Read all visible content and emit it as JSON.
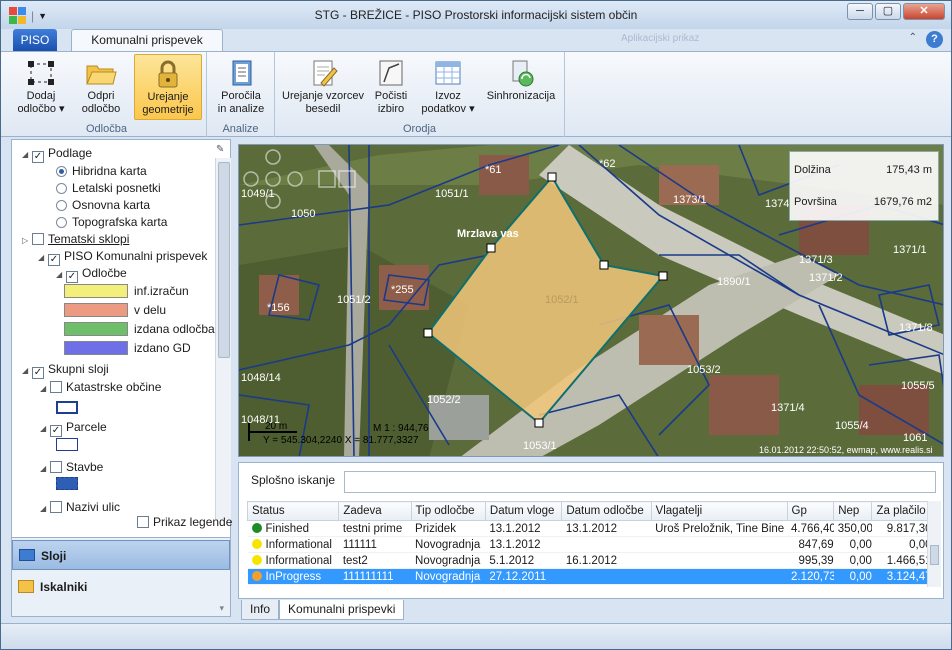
{
  "window": {
    "title": "STG - BREŽICE - PISO Prostorski informacijski sistem občin",
    "ghost_text": "Aplikacijski prikaz"
  },
  "tabs": {
    "piso": "PISO",
    "komunalni": "Komunalni prispevek"
  },
  "ribbon": {
    "groups": [
      {
        "label": "Odločba",
        "buttons": [
          {
            "line1": "Dodaj",
            "line2": "odločbo ▾",
            "icon": "add-polygon-icon"
          },
          {
            "line1": "Odpri",
            "line2": "odločbo",
            "icon": "folder-open-icon"
          },
          {
            "line1": "Urejanje",
            "line2": "geometrije",
            "icon": "lock-icon"
          }
        ]
      },
      {
        "label": "Analize",
        "buttons": [
          {
            "line1": "Poročila",
            "line2": "in analize",
            "icon": "report-book-icon"
          }
        ]
      },
      {
        "label": "Orodja",
        "buttons": [
          {
            "line1": "Urejanje vzorcev",
            "line2": "besedil",
            "icon": "edit-document-icon"
          },
          {
            "line1": "Počisti",
            "line2": "izbiro",
            "icon": "clear-selection-icon"
          },
          {
            "line1": "Izvoz",
            "line2": "podatkov ▾",
            "icon": "export-table-icon"
          },
          {
            "line1": "Sinhronizacija",
            "line2": "",
            "icon": "sync-icon"
          }
        ]
      }
    ]
  },
  "layers": {
    "podlage": "Podlage",
    "basemaps": [
      "Hibridna karta",
      "Letalski posnetki",
      "Osnovna karta",
      "Topografska karta"
    ],
    "tematski": "Tematski sklopi",
    "piso_kom": "PISO Komunalni prispevek",
    "odlocbe": "Odločbe",
    "legend": [
      {
        "label": "inf.izračun",
        "color": "#f2f07a"
      },
      {
        "label": "v delu",
        "color": "#ec9a82"
      },
      {
        "label": "izdana odločba",
        "color": "#6fbf6a"
      },
      {
        "label": "izdano GD",
        "color": "#6f6fe8"
      }
    ],
    "skupni": "Skupni sloji",
    "katastrske": "Katastrske občine",
    "parcele": "Parcele",
    "stavbe": "Stavbe",
    "nazivi": "Nazivi ulic",
    "prikaz_legende": "Prikaz legende"
  },
  "nav": {
    "sloji": "Sloji",
    "iskalniki": "Iskalniki"
  },
  "map": {
    "dolzina_label": "Dolžina",
    "dolzina": "175,43 m",
    "povrsina_label": "Površina",
    "povrsina": "1679,76 m2",
    "scale_bar": "20 m",
    "scale_ratio": "M 1 : 944,76",
    "coords": "Y = 545.304,2240  X = 81.777,3327",
    "stamp": "16.01.2012 22:50:52, ewmap, www.realis.si",
    "parcels": [
      "1051/1",
      "1050",
      "1049/1",
      "1373/1",
      "1374",
      "1371/1",
      "1371/3",
      "1371/2",
      "1371/8",
      "1890/1",
      "1052/1",
      "1051/2",
      "1053/2",
      "1052/2",
      "1053/1",
      "1055/4",
      "1048/14",
      "1048/11",
      "*61",
      "*62",
      "*156",
      "*255",
      "Mrzlava vas",
      "1061",
      "1055/5",
      "1371/4"
    ]
  },
  "search": {
    "label": "Splošno iskanje",
    "value": ""
  },
  "table": {
    "columns": [
      "Status",
      "Zadeva",
      "Tip odločbe",
      "Datum vloge",
      "Datum odločbe",
      "Vlagatelji",
      "Gp",
      "Nep",
      "Za plačilo"
    ],
    "rows": [
      {
        "status": "Finished",
        "color": "#1f8a2a",
        "zadeva": "testni prime",
        "tip": "Prizidek",
        "vloge": "13.1.2012",
        "odlocbe": "13.1.2012",
        "vlagatelji": "Uroš Preložnik, Tine Bine",
        "gp": "4.766,40",
        "nep": "350,00",
        "placilo": "9.817,30"
      },
      {
        "status": "Informational",
        "color": "#f5e500",
        "zadeva": "111111",
        "tip": "Novogradnja",
        "vloge": "13.1.2012",
        "odlocbe": "",
        "vlagatelji": "",
        "gp": "847,69",
        "nep": "0,00",
        "placilo": "0,00"
      },
      {
        "status": "Informational",
        "color": "#f5e500",
        "zadeva": "test2",
        "tip": "Novogradnja",
        "vloge": "5.1.2012",
        "odlocbe": "16.1.2012",
        "vlagatelji": "",
        "gp": "995,39",
        "nep": "0,00",
        "placilo": "1.466,51"
      },
      {
        "status": "InProgress",
        "color": "#f0a030",
        "zadeva": "111111111",
        "tip": "Novogradnja",
        "vloge": "27.12.2011",
        "odlocbe": "",
        "vlagatelji": "",
        "gp": "2.120,73",
        "nep": "0,00",
        "placilo": "3.124,47"
      }
    ]
  },
  "bottom_tabs": [
    "Info",
    "Komunalni prispevki"
  ]
}
